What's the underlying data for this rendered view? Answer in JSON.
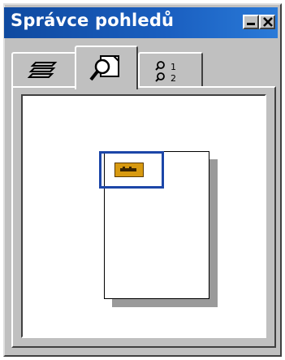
{
  "window": {
    "title": "Správce pohledů"
  },
  "titlebar_buttons": {
    "minimize_icon": "minimize-icon",
    "close_icon": "close-icon"
  },
  "tabs": [
    {
      "icon": "layers-icon",
      "selected": false
    },
    {
      "icon": "page-magnifier-icon",
      "selected": true
    },
    {
      "icon": "numbered-views-icon",
      "selected": false
    }
  ],
  "colors": {
    "titlebar": "#0f4aa0",
    "view_rect": "#1c46a8",
    "thumb": "#d89a10"
  }
}
